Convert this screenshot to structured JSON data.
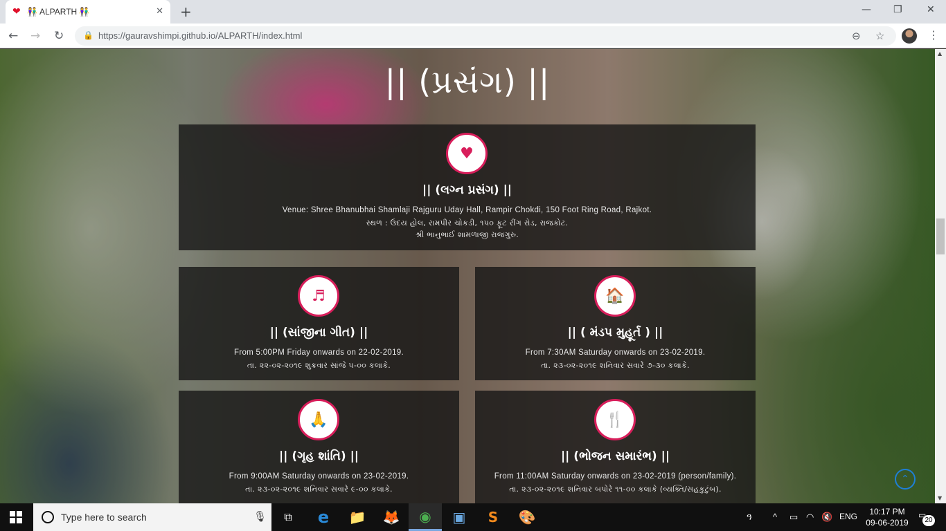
{
  "browser": {
    "tab_title": "ALPARTH",
    "tab_favicon": "❤",
    "tab_emoji": "👫",
    "tab_close": "✕",
    "new_tab": "+",
    "window_controls": {
      "minimize": "—",
      "restore": "❐",
      "close": "✕"
    },
    "nav": {
      "back": "←",
      "forward": "→",
      "reload": "↻"
    },
    "lock_icon": "🔒",
    "url_host": "https://gauravshimpi.github.io",
    "url_path": "/ALPARTH/index.html",
    "zoom_icon": "⊖",
    "star_icon": "☆",
    "menu_icon": "⋮"
  },
  "page": {
    "section_title": "|| (પ્રસંગ) ||",
    "cards": [
      {
        "icon": "♥",
        "icon_name": "heart-icon",
        "title": "|| (લગ્ન પ્રસંગ) ||",
        "lines": [
          "Venue: Shree Bhanubhai Shamlaji Rajguru Uday Hall, Rampir Chokdi, 150 Foot Ring Road, Rajkot.",
          "સ્થળ : ઉદય હોલ, રામપીર ચોકડી, ૧૫૦ ફૂટ રીંગ રોડ, રાજકોટ.",
          "શ્રી ભાનુભાઈ શામળાજી રાજગુરુ."
        ]
      },
      {
        "icon": "♬",
        "icon_name": "music-icon",
        "title": "|| (સાંજીના ગીત) ||",
        "lines": [
          "From 5:00PM Friday onwards on 22-02-2019.",
          "તા. ૨૨-૦૨-૨૦૧૯ શુક્રવાર સાંજે ૫-૦૦ કલાકે."
        ]
      },
      {
        "icon": "🏠",
        "icon_name": "house-icon",
        "title": "|| ( મંડપ મુહૂર્ત ) ||",
        "lines": [
          "From 7:30AM Saturday onwards on 23-02-2019.",
          "તા. ૨૩-૦૨-૨૦૧૯ શનિવાર સવારે ૭-૩૦ કલાકે."
        ]
      },
      {
        "icon": "🙏",
        "icon_name": "praying-hands-icon",
        "title": "|| (ગૃહ શાંતિ) ||",
        "lines": [
          "From 9:00AM Saturday onwards on 23-02-2019.",
          "તા. ૨૩-૦૨-૨૦૧૯ શનિવાર સવારે ૯-૦૦ કલાકે."
        ]
      },
      {
        "icon": "🍴",
        "icon_name": "cutlery-icon",
        "title": "|| (ભોજન સમારંભ) ||",
        "lines": [
          "From 11:00AM Saturday onwards on 23-02-2019 (person/family).",
          "તા. ૨૩-૦૨-૨૦૧૯ શનિવાર બપોરે ૧૧-૦૦ કલાકે (વ્યક્તિ/સહકુટુંબ)."
        ]
      }
    ],
    "scroll_top_icon": "⌃"
  },
  "taskbar": {
    "search_placeholder": "Type here to search",
    "mic_icon": "🎙",
    "apps": [
      {
        "name": "task-view",
        "glyph": "⧉"
      },
      {
        "name": "edge",
        "glyph": "e"
      },
      {
        "name": "file-explorer",
        "glyph": "📁"
      },
      {
        "name": "firefox",
        "glyph": "🦊"
      },
      {
        "name": "chrome",
        "glyph": "◉"
      },
      {
        "name": "virtualbox",
        "glyph": "▣"
      },
      {
        "name": "sublime-text",
        "glyph": "S"
      },
      {
        "name": "paint",
        "glyph": "🎨"
      }
    ],
    "tray": {
      "people": "ዓ",
      "chevron": "^",
      "battery": "▭",
      "wifi": "◠",
      "volume": "🔇",
      "language": "ENG"
    },
    "time": "10:17 PM",
    "date": "09-06-2019",
    "notification_count": "20"
  },
  "colors": {
    "accent": "#d81e5b",
    "scroll_top": "#1e7fd6"
  }
}
